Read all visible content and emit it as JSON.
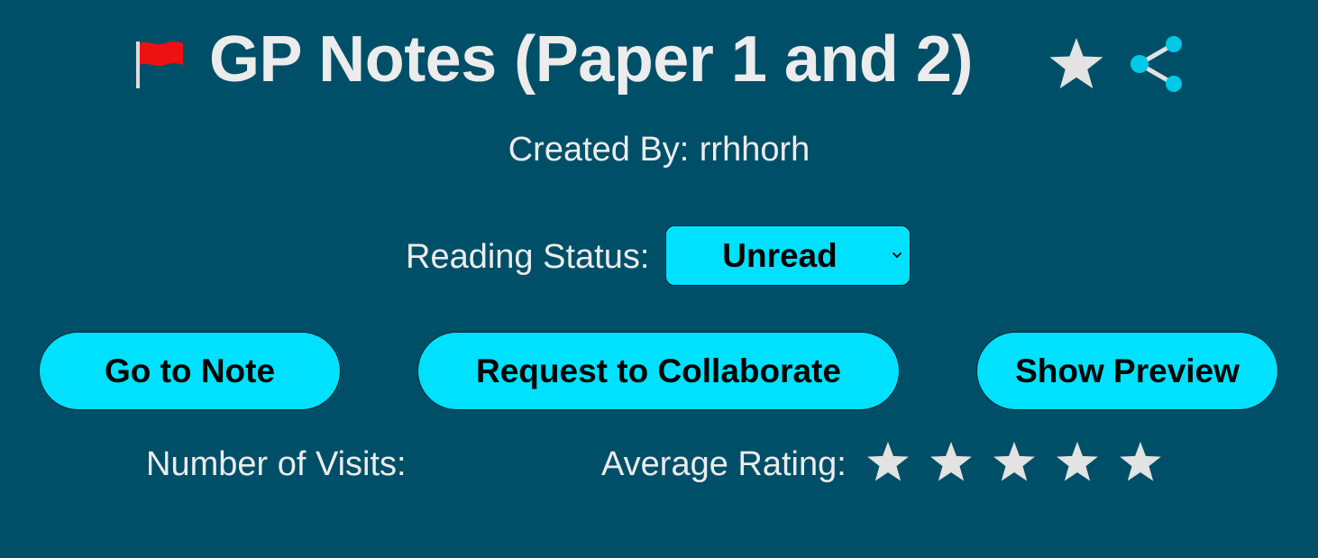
{
  "note": {
    "title": "GP Notes (Paper 1 and 2)",
    "created_by_label": "Created By:",
    "created_by_user": "rrhhorh"
  },
  "icons": {
    "flag": "red-flag-icon",
    "favorite": "star-icon",
    "share": "share-icon",
    "dropdown": "chevron-down-icon",
    "rating": "star-icon"
  },
  "reading_status": {
    "label": "Reading Status:",
    "selected": "Unread"
  },
  "buttons": {
    "go_to_note": "Go to Note",
    "request_collaborate": "Request to Collaborate",
    "show_preview": "Show Preview"
  },
  "stats": {
    "visits_label": "Number of Visits:",
    "average_rating_label": "Average Rating:",
    "rating_star_count": 5
  },
  "colors": {
    "background": "#004f68",
    "accent": "#00e1ff",
    "text": "#ececec",
    "flag_red": "#ee1111",
    "share_blue": "#00c8e8",
    "star_grey": "#e3e3e3"
  }
}
